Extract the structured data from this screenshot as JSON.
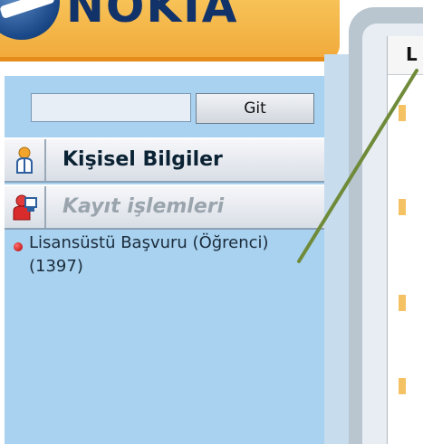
{
  "header": {
    "logo_text": "NOKIA"
  },
  "sidebar": {
    "search": {
      "value": "",
      "placeholder": ""
    },
    "go_button_label": "Git",
    "menu": [
      {
        "label": "Kişisel Bilgiler"
      },
      {
        "label": "Kayıt işlemleri"
      }
    ],
    "items": [
      {
        "label": "Lisansüstü Başvuru (Öğrenci) (1397)"
      }
    ]
  },
  "main": {
    "tab_header_label": "L"
  },
  "colors": {
    "header": "#f1a93a",
    "sidebar": "#a8d2f0",
    "annotation_line": "#6f8b3a"
  }
}
